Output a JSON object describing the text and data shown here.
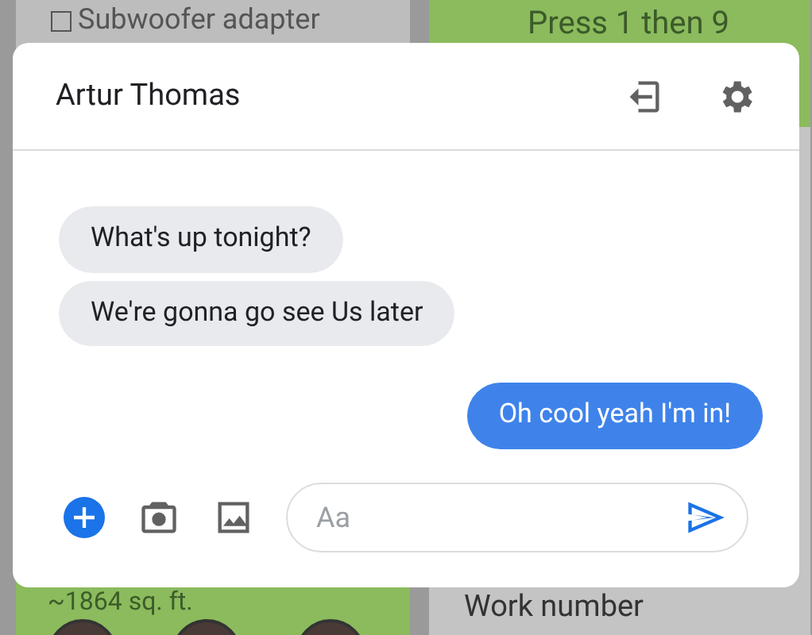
{
  "background": {
    "cards": [
      {
        "text": "Subwoofer adapter",
        "kind": "checkbox",
        "checked": false
      },
      {
        "text": "Press 1 then 9",
        "kind": "plain"
      },
      {
        "text": "~1864 sq. ft.",
        "kind": "avatars"
      },
      {
        "text": "Work number",
        "kind": "heading"
      }
    ]
  },
  "chat": {
    "title": "Artur Thomas",
    "messages": [
      {
        "text": "What's up tonight?",
        "outgoing": false
      },
      {
        "text": "We're gonna go see Us later",
        "outgoing": false
      },
      {
        "text": "Oh cool yeah I'm in!",
        "outgoing": true
      }
    ],
    "composer": {
      "placeholder": "Aa"
    }
  }
}
